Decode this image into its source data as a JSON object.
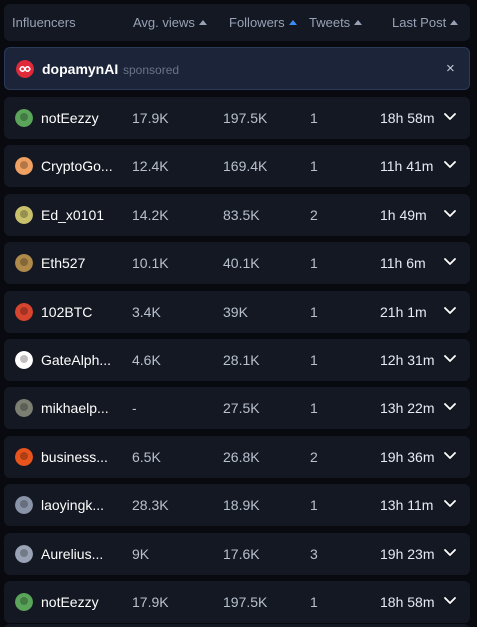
{
  "header": {
    "col_influencers": "Influencers",
    "col_views": "Avg. views",
    "col_followers": "Followers",
    "col_tweets": "Tweets",
    "col_lastpost": "Last Post"
  },
  "sponsored": {
    "name": "dopamynAI",
    "tag": "sponsored",
    "close": "×"
  },
  "colors": {
    "background": "#080a10",
    "row": "#141822",
    "sponsored_bg": "#1b2438",
    "accent": "#3b8cf0"
  },
  "rows": [
    {
      "name": "notEezzy",
      "views": "17.9K",
      "followers": "197.5K",
      "tweets": "1",
      "last_post": "18h 58m",
      "avatar_color": "#5aa55a"
    },
    {
      "name": "CryptoGo...",
      "views": "12.4K",
      "followers": "169.4K",
      "tweets": "1",
      "last_post": "11h 41m",
      "avatar_color": "#f0a060"
    },
    {
      "name": "Ed_x0101",
      "views": "14.2K",
      "followers": "83.5K",
      "tweets": "2",
      "last_post": "1h 49m",
      "avatar_color": "#c8c06a"
    },
    {
      "name": "Eth527",
      "views": "10.1K",
      "followers": "40.1K",
      "tweets": "1",
      "last_post": "11h 6m",
      "avatar_color": "#b08a4a"
    },
    {
      "name": "102BTC",
      "views": "3.4K",
      "followers": "39K",
      "tweets": "1",
      "last_post": "21h 1m",
      "avatar_color": "#d8452e"
    },
    {
      "name": "GateAlph...",
      "views": "4.6K",
      "followers": "28.1K",
      "tweets": "1",
      "last_post": "12h 31m",
      "avatar_color": "#ffffff"
    },
    {
      "name": "mikhaelp...",
      "views": "-",
      "followers": "27.5K",
      "tweets": "1",
      "last_post": "13h 22m",
      "avatar_color": "#7a7f72"
    },
    {
      "name": "business...",
      "views": "6.5K",
      "followers": "26.8K",
      "tweets": "2",
      "last_post": "19h 36m",
      "avatar_color": "#e8541c"
    },
    {
      "name": "laoyingk...",
      "views": "28.3K",
      "followers": "18.9K",
      "tweets": "1",
      "last_post": "13h 11m",
      "avatar_color": "#8a94a8"
    },
    {
      "name": "Aurelius...",
      "views": "9K",
      "followers": "17.6K",
      "tweets": "3",
      "last_post": "19h 23m",
      "avatar_color": "#9aa3b5"
    },
    {
      "name": "notEezzy",
      "views": "17.9K",
      "followers": "197.5K",
      "tweets": "1",
      "last_post": "18h 58m",
      "avatar_color": "#5aa55a"
    }
  ]
}
